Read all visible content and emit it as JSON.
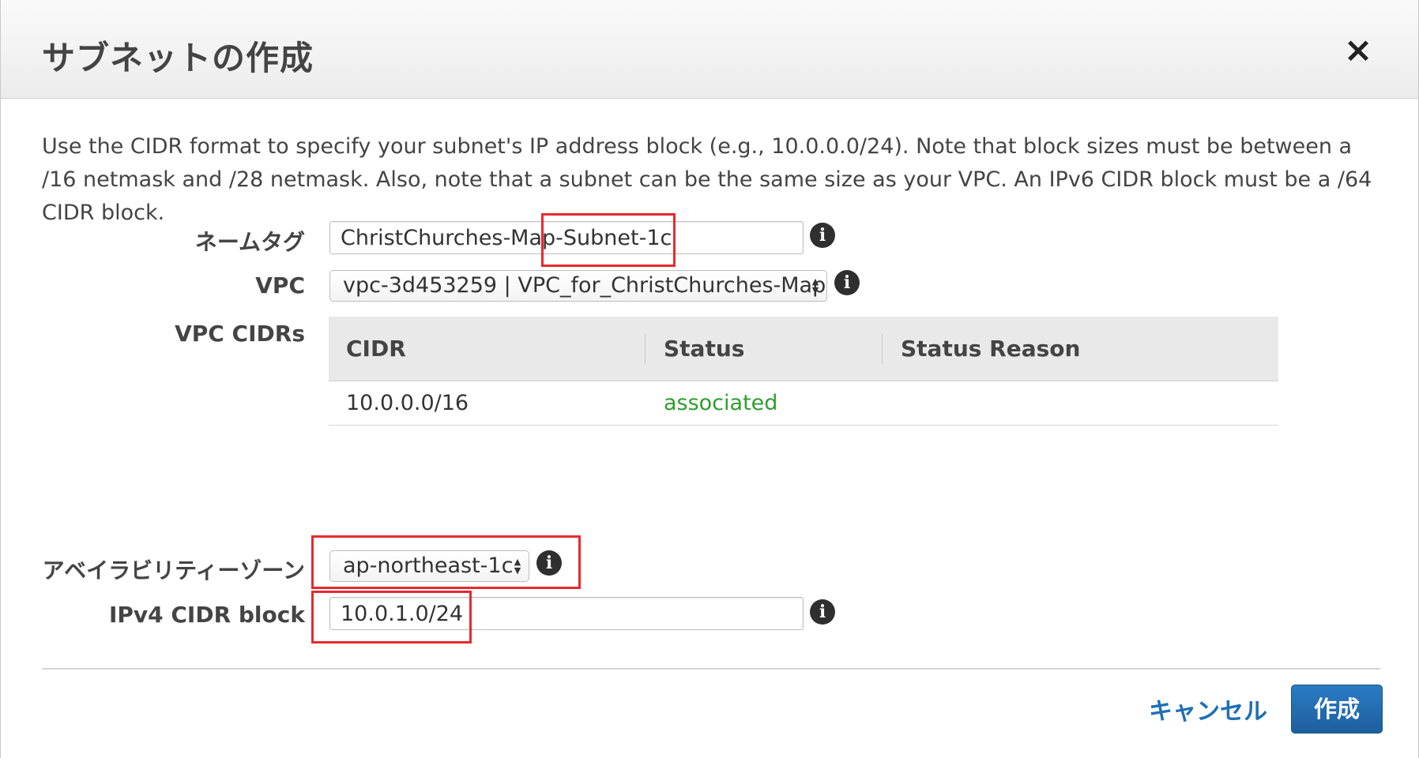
{
  "dialog": {
    "title": "サブネットの作成",
    "close_icon": "×",
    "description": "Use the CIDR format to specify your subnet's IP address block (e.g., 10.0.0.0/24). Note that block sizes must be between a /16 netmask and /28 netmask. Also, note that a subnet can be the same size as your VPC. An IPv6 CIDR block must be a /64 CIDR block."
  },
  "form": {
    "name_tag": {
      "label": "ネームタグ",
      "value": "ChristChurches-Map-Subnet-1c"
    },
    "vpc": {
      "label": "VPC",
      "selected": "vpc-3d453259 | VPC_for_ChristChurches-Map"
    },
    "vpc_cidrs": {
      "label": "VPC CIDRs",
      "columns": [
        "CIDR",
        "Status",
        "Status Reason"
      ],
      "rows": [
        {
          "cidr": "10.0.0.0/16",
          "status": "associated",
          "status_reason": ""
        }
      ]
    },
    "availability_zone": {
      "label": "アベイラビリティーゾーン",
      "selected": "ap-northeast-1c"
    },
    "ipv4_cidr": {
      "label": "IPv4 CIDR block",
      "value": "10.0.1.0/24"
    }
  },
  "footer": {
    "cancel_label": "キャンセル",
    "create_label": "作成"
  },
  "icons": {
    "info": "i",
    "select_arrows": "▲▼"
  },
  "colors": {
    "accent": "#1f6fb5",
    "status_ok": "#2e9e2e",
    "highlight": "#e8292d"
  }
}
